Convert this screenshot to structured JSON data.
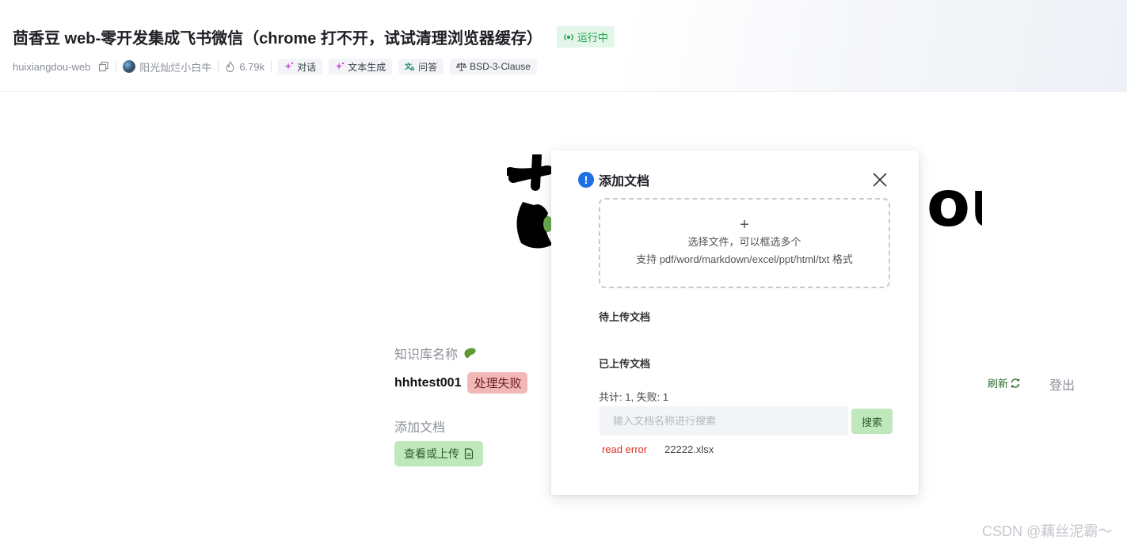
{
  "header": {
    "title": "茴香豆 web-零开发集成飞书微信（chrome 打不开，试试清理浏览器缓存）",
    "status": "运行中",
    "repo": "huixiangdou-web",
    "author": "阳光灿烂小白牛",
    "likes": "6.79k",
    "tags": [
      "对话",
      "文本生成",
      "问答",
      "BSD-3-Clause"
    ]
  },
  "logo": {
    "text": "ou"
  },
  "page": {
    "kb_label": "知识库名称",
    "kb_name": "hhhtest001",
    "kb_status": "处理失败",
    "add_doc_label": "添加文档",
    "view_upload_label": "查看或上传",
    "refresh_label": "刷新",
    "logout_label": "登出"
  },
  "modal": {
    "title": "添加文档",
    "dropzone": {
      "plus": "+",
      "line1": "选择文件，可以框选多个",
      "line2": "支持 pdf/word/markdown/excel/ppt/html/txt 格式"
    },
    "pending_label": "待上传文档",
    "uploaded_label": "已上传文档",
    "stats": "共计: 1, 失败: 1",
    "search_placeholder": "输入文档名称进行搜索",
    "search_button": "搜索",
    "files": [
      {
        "status": "read error",
        "name": "22222.xlsx"
      }
    ]
  },
  "watermark": "CSDN @藕丝泥霸～",
  "colors": {
    "accent_green": "#c0e8bd",
    "status_green": "#22a34a",
    "error_red": "#d93025",
    "fail_badge": "#f2b8b8",
    "info_blue": "#1f6fe5"
  },
  "icons": {
    "status": "broadcast-icon",
    "copy": "copy-icon",
    "likes": "flame-icon",
    "tags": [
      "sparkle-icon",
      "sparkle-icon",
      "translate-icon",
      "scale-icon"
    ],
    "kb_label": "bean-icon",
    "view_upload": "document-icon",
    "refresh": "refresh-icon",
    "modal_info": "info-icon",
    "modal_close": "close-icon"
  }
}
